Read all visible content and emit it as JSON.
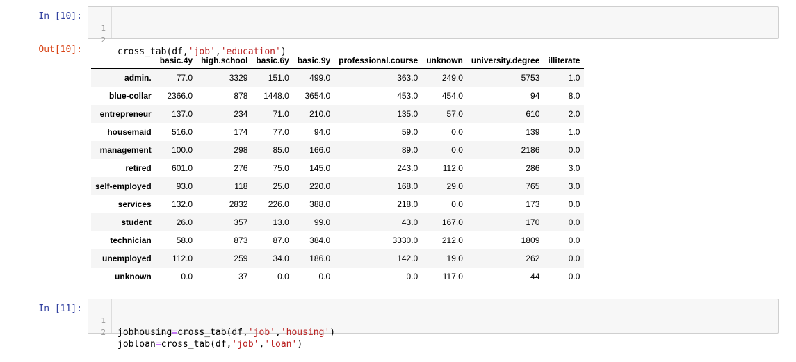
{
  "cells": {
    "in10": {
      "prompt": "In [10]:",
      "lines": [
        {
          "num": "1",
          "text": ""
        },
        {
          "num": "2",
          "fn": "cross_tab",
          "args": "(df,",
          "s1": "'job'",
          "sep": ",",
          "s2": "'education'",
          "tail": ")"
        }
      ]
    },
    "out10": {
      "prompt": "Out[10]:"
    },
    "in11": {
      "prompt": "In [11]:",
      "lines": [
        {
          "num": "1",
          "var": "jobhousing",
          "eq": "=",
          "fn": "cross_tab(df,",
          "s1": "'job'",
          "sep": ",",
          "s2": "'housing'",
          "tail": ")"
        },
        {
          "num": "2",
          "var": "jobloan",
          "eq": "=",
          "fn": "cross_tab(df,",
          "s1": "'job'",
          "sep": ",",
          "s2": "'loan'",
          "tail": ")"
        }
      ]
    }
  },
  "dataframe": {
    "columns": [
      "basic.4y",
      "high.school",
      "basic.6y",
      "basic.9y",
      "professional.course",
      "unknown",
      "university.degree",
      "illiterate"
    ],
    "rows": [
      {
        "index": "admin.",
        "values": [
          "77.0",
          "3329",
          "151.0",
          "499.0",
          "363.0",
          "249.0",
          "5753",
          "1.0"
        ]
      },
      {
        "index": "blue-collar",
        "values": [
          "2366.0",
          "878",
          "1448.0",
          "3654.0",
          "453.0",
          "454.0",
          "94",
          "8.0"
        ]
      },
      {
        "index": "entrepreneur",
        "values": [
          "137.0",
          "234",
          "71.0",
          "210.0",
          "135.0",
          "57.0",
          "610",
          "2.0"
        ]
      },
      {
        "index": "housemaid",
        "values": [
          "516.0",
          "174",
          "77.0",
          "94.0",
          "59.0",
          "0.0",
          "139",
          "1.0"
        ]
      },
      {
        "index": "management",
        "values": [
          "100.0",
          "298",
          "85.0",
          "166.0",
          "89.0",
          "0.0",
          "2186",
          "0.0"
        ]
      },
      {
        "index": "retired",
        "values": [
          "601.0",
          "276",
          "75.0",
          "145.0",
          "243.0",
          "112.0",
          "286",
          "3.0"
        ]
      },
      {
        "index": "self-employed",
        "values": [
          "93.0",
          "118",
          "25.0",
          "220.0",
          "168.0",
          "29.0",
          "765",
          "3.0"
        ]
      },
      {
        "index": "services",
        "values": [
          "132.0",
          "2832",
          "226.0",
          "388.0",
          "218.0",
          "0.0",
          "173",
          "0.0"
        ]
      },
      {
        "index": "student",
        "values": [
          "26.0",
          "357",
          "13.0",
          "99.0",
          "43.0",
          "167.0",
          "170",
          "0.0"
        ]
      },
      {
        "index": "technician",
        "values": [
          "58.0",
          "873",
          "87.0",
          "384.0",
          "3330.0",
          "212.0",
          "1809",
          "0.0"
        ]
      },
      {
        "index": "unemployed",
        "values": [
          "112.0",
          "259",
          "34.0",
          "186.0",
          "142.0",
          "19.0",
          "262",
          "0.0"
        ]
      },
      {
        "index": "unknown",
        "values": [
          "0.0",
          "37",
          "0.0",
          "0.0",
          "0.0",
          "117.0",
          "44",
          "0.0"
        ]
      }
    ]
  }
}
